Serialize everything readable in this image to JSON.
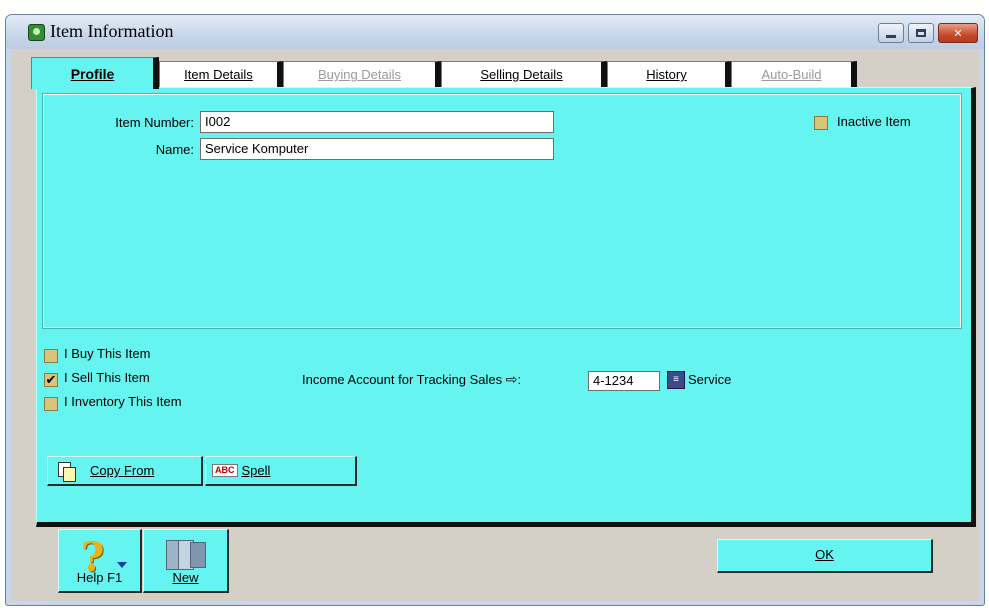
{
  "window": {
    "title": "Item Information",
    "minimize_label": "",
    "maximize_label": "",
    "close_label": "✕"
  },
  "tabs": [
    {
      "label": "Profile",
      "state": "active"
    },
    {
      "label": "Item Details",
      "state": "enabled"
    },
    {
      "label": "Buying Details",
      "state": "disabled"
    },
    {
      "label": "Selling Details",
      "state": "enabled"
    },
    {
      "label": "History",
      "state": "enabled"
    },
    {
      "label": "Auto-Build",
      "state": "disabled"
    }
  ],
  "profile": {
    "item_number_label": "Item Number:",
    "item_number_value": "I002",
    "name_label": "Name:",
    "name_value": "Service Komputer",
    "inactive_label": "Inactive Item",
    "inactive_checked": false
  },
  "options": {
    "buy_label": "I Buy This Item",
    "buy_checked": false,
    "sell_label": "I Sell This Item",
    "sell_checked": true,
    "sell_check_glyph": "✔",
    "inventory_label": "I Inventory This Item",
    "inventory_checked": false
  },
  "income_account": {
    "label": "Income Account for Tracking Sales",
    "arrow_glyph": "⇨",
    "colon": ":",
    "account_number": "4-1234",
    "account_name": "Service"
  },
  "panel_buttons": {
    "copy_from": "Copy From",
    "spell": "Spell",
    "spell_icon_text": "ABC"
  },
  "footer": {
    "help_label": "Help F1",
    "help_glyph": "?",
    "new_label": "New",
    "ok_label": "OK"
  },
  "colors": {
    "panel": "#66f4f0",
    "checkbox": "#d7c67a",
    "titlebar": "#c9d8ea",
    "close_button": "#c74a2c"
  }
}
